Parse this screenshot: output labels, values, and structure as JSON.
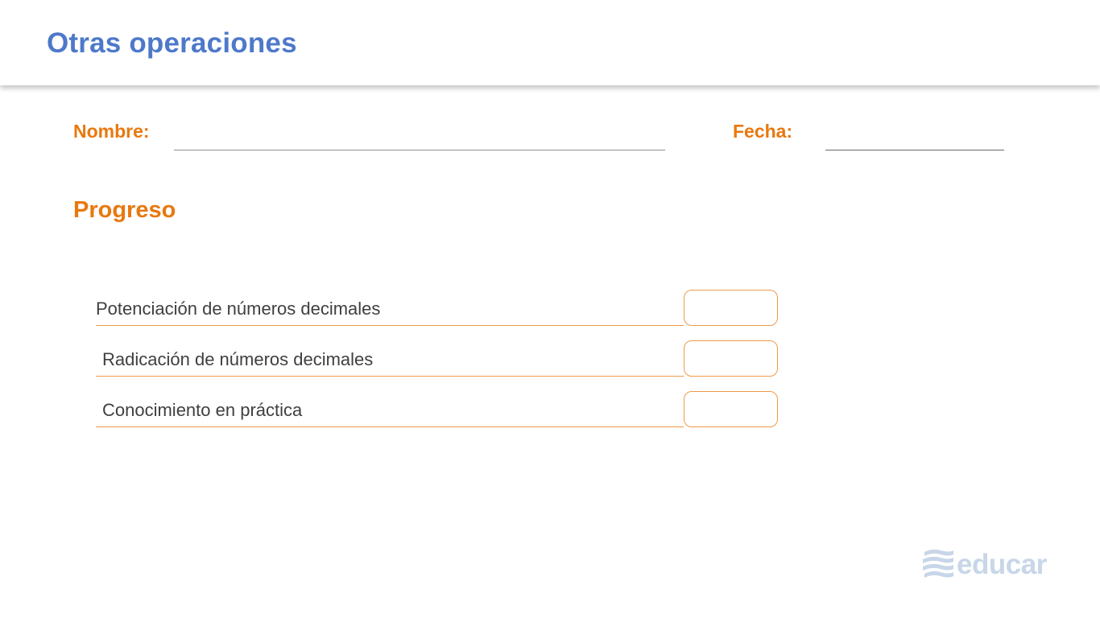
{
  "header": {
    "title": "Otras operaciones"
  },
  "form": {
    "name_label": "Nombre:",
    "date_label": "Fecha:"
  },
  "progress": {
    "title": "Progreso",
    "items": [
      {
        "label": "Potenciación de números decimales"
      },
      {
        "label": "Radicación de números decimales"
      },
      {
        "label": "Conocimiento en práctica"
      }
    ]
  },
  "brand": {
    "logo_text": "educar",
    "logo_icon": "educar-logo-icon",
    "accent_color": "#e9780e",
    "title_color": "#4e79c9"
  }
}
